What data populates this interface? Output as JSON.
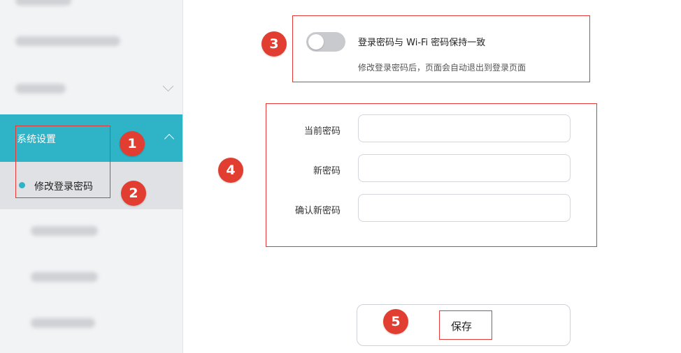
{
  "sidebar": {
    "system_settings_label": "系统设置",
    "change_password_label": "修改登录密码"
  },
  "sync_wifi": {
    "title": "登录密码与 Wi-Fi 密码保持一致",
    "description": "修改登录密码后，页面会自动退出到登录页面",
    "enabled": false
  },
  "form": {
    "current_password_label": "当前密码",
    "new_password_label": "新密码",
    "confirm_password_label": "确认新密码",
    "current_password_value": "",
    "new_password_value": "",
    "confirm_password_value": ""
  },
  "save_label": "保存",
  "annotations": [
    "1",
    "2",
    "3",
    "4",
    "5"
  ],
  "colors": {
    "accent": "#2fb4c7",
    "annotation_red": "#e23d31"
  }
}
